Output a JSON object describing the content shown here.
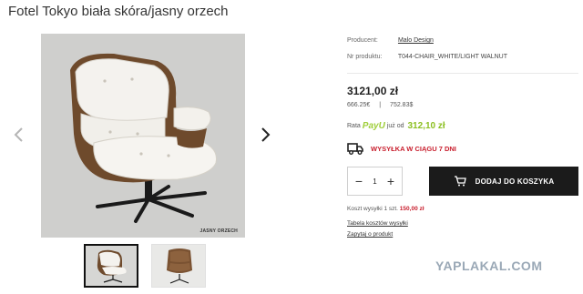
{
  "product": {
    "title": "Fotel Tokyo biała skóra/jasny orzech",
    "image_caption": "JASNY ORZECH"
  },
  "meta": {
    "producer_label": "Producent:",
    "producer_value": "Malo Design",
    "sku_label": "Nr produktu:",
    "sku_value": "T044-CHAIR_WHITE/LIGHT WALNUT"
  },
  "pricing": {
    "price": "3121,00 zł",
    "price_eur": "666.25€",
    "separator": "|",
    "price_usd": "752.83$",
    "rata_label": "Rata",
    "payu_brand": "PayU",
    "rata_from": "już od",
    "rata_price": "312,10 zł"
  },
  "delivery": {
    "text": "WYSYŁKA W CIĄGU 7 DNI"
  },
  "cart": {
    "minus": "−",
    "quantity": "1",
    "plus": "+",
    "add_label": "DODAJ DO KOSZYKA"
  },
  "shipping": {
    "label": "Koszt wysyłki 1 szt.",
    "amount": "150,00 zł"
  },
  "links": {
    "shipping_table": "Tabela kosztów wysyłki",
    "ask": "Zapytaj o produkt"
  },
  "watermark": "YAPLAKAL.COM",
  "colors": {
    "accent_red": "#c81d2c",
    "payu_green": "#9fce3a",
    "button_dark": "#1b1b1b"
  }
}
